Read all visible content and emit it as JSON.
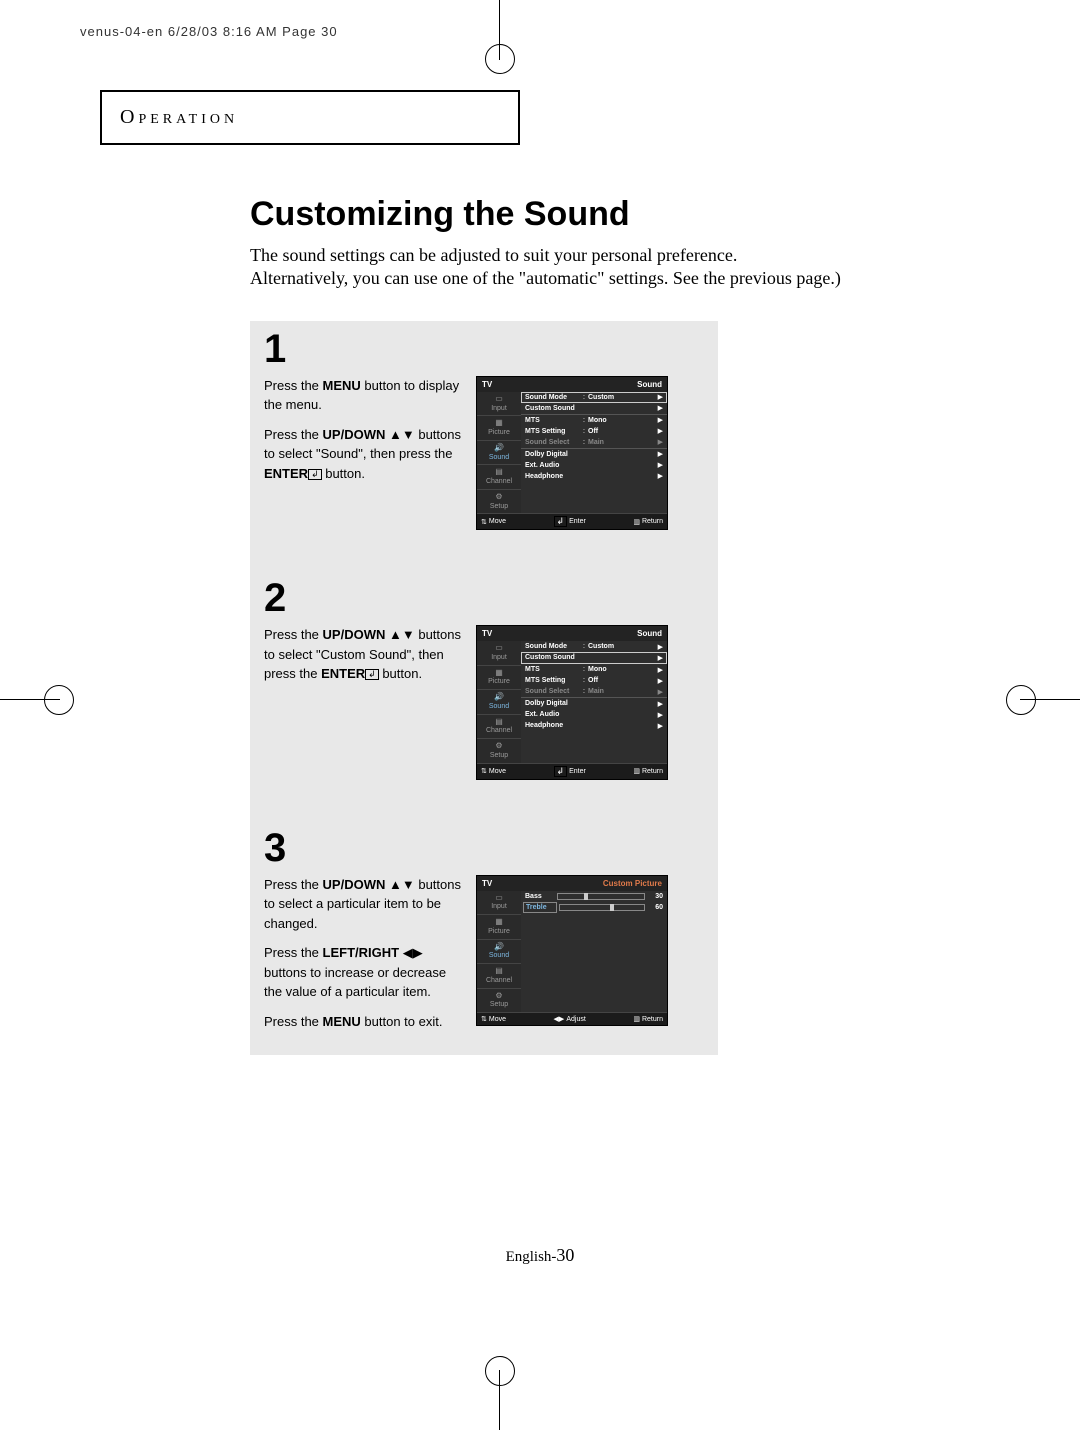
{
  "header_line": "venus-04-en  6/28/03 8:16 AM  Page 30",
  "section_label": "Operation",
  "title": "Customizing the Sound",
  "intro_line1": "The sound settings can be adjusted to suit your personal preference.",
  "intro_line2": "Alternatively, you can use one of the \"automatic\" settings. See the previous page.)",
  "steps": {
    "s1": {
      "num": "1",
      "p1a": "Press the ",
      "p1b": "MENU",
      "p1c": " button to display the menu.",
      "p2a": "Press the ",
      "p2b": "UP/DOWN",
      "p2c": " buttons to select \"Sound\", then press the ",
      "p2d": "ENTER",
      "p2e": " button."
    },
    "s2": {
      "num": "2",
      "p1a": "Press the ",
      "p1b": "UP/DOWN",
      "p1c": " buttons to select \"Custom Sound\", then press the ",
      "p1d": "ENTER",
      "p1e": " button."
    },
    "s3": {
      "num": "3",
      "p1a": "Press the ",
      "p1b": "UP/DOWN",
      "p1c": " buttons to select a particular item to be changed.",
      "p2a": "Press the ",
      "p2b": "LEFT/RIGHT",
      "p2c": " buttons to increase or decrease the value of a particular item.",
      "p3a": "Press the ",
      "p3b": "MENU",
      "p3c": " button to exit."
    }
  },
  "osd_common": {
    "tv": "TV",
    "side": {
      "input": "Input",
      "picture": "Picture",
      "sound": "Sound",
      "channel": "Channel",
      "setup": "Setup"
    },
    "footer": {
      "move": "Move",
      "enter": "Enter",
      "adjust": "Adjust",
      "return": "Return"
    }
  },
  "osd1": {
    "title_right": "Sound",
    "rows": [
      {
        "label": "Sound Mode",
        "val": "Custom",
        "sel": true
      },
      {
        "label": "Custom Sound",
        "val": ""
      },
      {
        "label": "MTS",
        "val": "Mono"
      },
      {
        "label": "MTS Setting",
        "val": "Off"
      },
      {
        "label": "Sound Select",
        "val": "Main",
        "dim": true
      },
      {
        "label": "Dolby Digital",
        "val": ""
      },
      {
        "label": "Ext. Audio",
        "val": ""
      },
      {
        "label": "Headphone",
        "val": ""
      }
    ]
  },
  "osd2": {
    "title_right": "Sound",
    "rows": [
      {
        "label": "Sound Mode",
        "val": "Custom"
      },
      {
        "label": "Custom Sound",
        "val": "",
        "sel": true
      },
      {
        "label": "MTS",
        "val": "Mono"
      },
      {
        "label": "MTS Setting",
        "val": "Off"
      },
      {
        "label": "Sound Select",
        "val": "Main",
        "dim": true
      },
      {
        "label": "Dolby Digital",
        "val": ""
      },
      {
        "label": "Ext. Audio",
        "val": ""
      },
      {
        "label": "Headphone",
        "val": ""
      }
    ]
  },
  "osd3": {
    "title_right": "Custom Picture",
    "sliders": [
      {
        "label": "Bass",
        "value": 30,
        "pct": 30
      },
      {
        "label": "Treble",
        "value": 60,
        "pct": 60,
        "sel": true
      }
    ]
  },
  "footer_label": "English-",
  "footer_page": "30"
}
